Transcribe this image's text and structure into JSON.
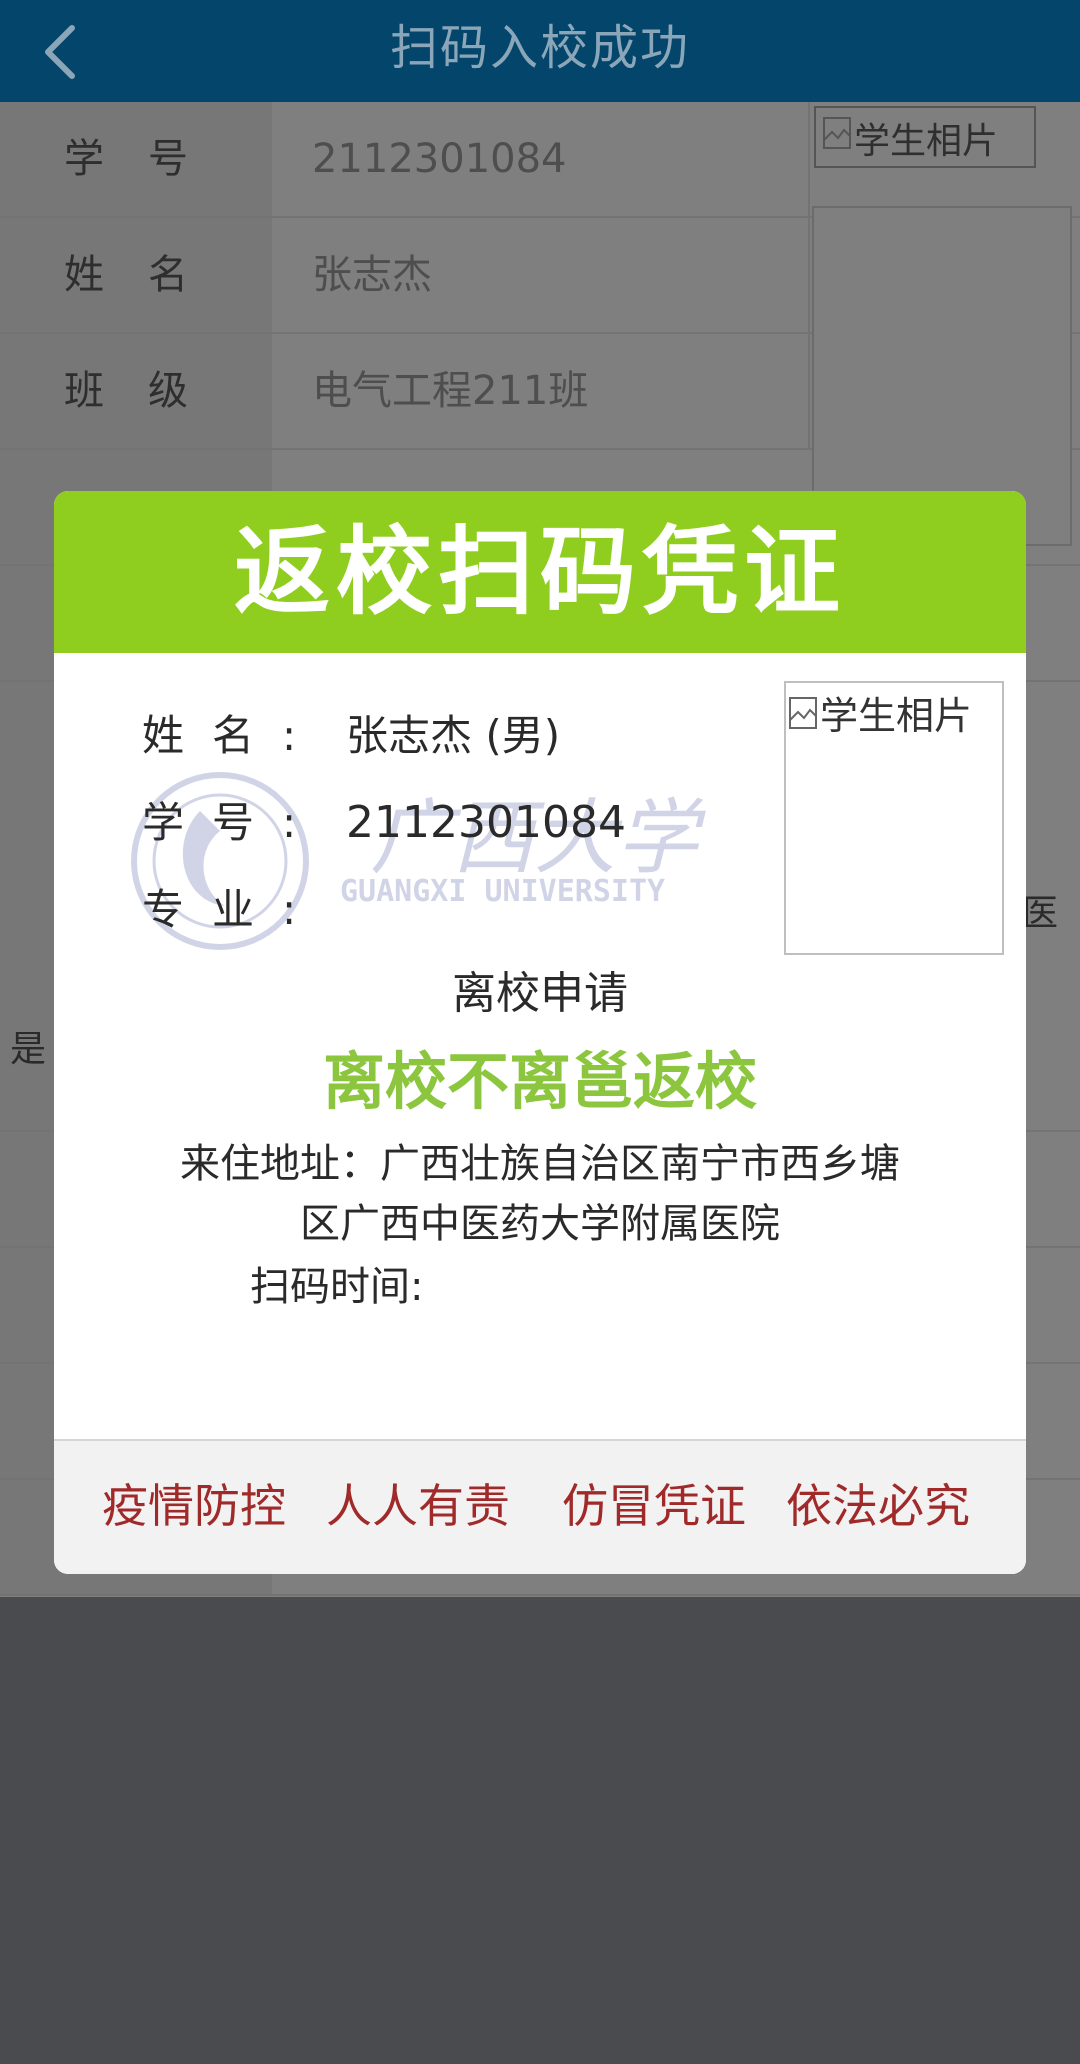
{
  "header": {
    "title": "扫码入校成功"
  },
  "background_rows": {
    "labels": [
      "学号",
      "姓名",
      "班级"
    ],
    "values": [
      "2112301084",
      "张志杰",
      "电气工程211班"
    ]
  },
  "photo_alt": "学生相片",
  "side_fragments": {
    "right": "医",
    "left": "是"
  },
  "modal": {
    "title": "返校扫码凭证",
    "name_label": "姓名:",
    "name_value": "张志杰 (男)",
    "id_label": "学号:",
    "id_value": "2112301084",
    "major_label": "专业:",
    "major_value": "",
    "photo_alt": "学生相片",
    "watermark_en": "GUANGXI UNIVERSITY",
    "watermark_cn": "广西大学",
    "request_label": "离校申请",
    "status": "离校不离邕返校",
    "address_line1": "来住地址：广西壮族自治区南宁市西乡塘",
    "address_line2": "区广西中医药大学附属医院",
    "scan_time_label": "扫码时间:",
    "scan_time_value": "",
    "footer": [
      "疫情防控",
      "人人有责",
      "仿冒凭证",
      "依法必究"
    ]
  },
  "colors": {
    "header_bg": "#04466b",
    "modal_head": "#8fce1f",
    "status_green": "#8cc63f",
    "footer_red": "#a02a2a"
  }
}
